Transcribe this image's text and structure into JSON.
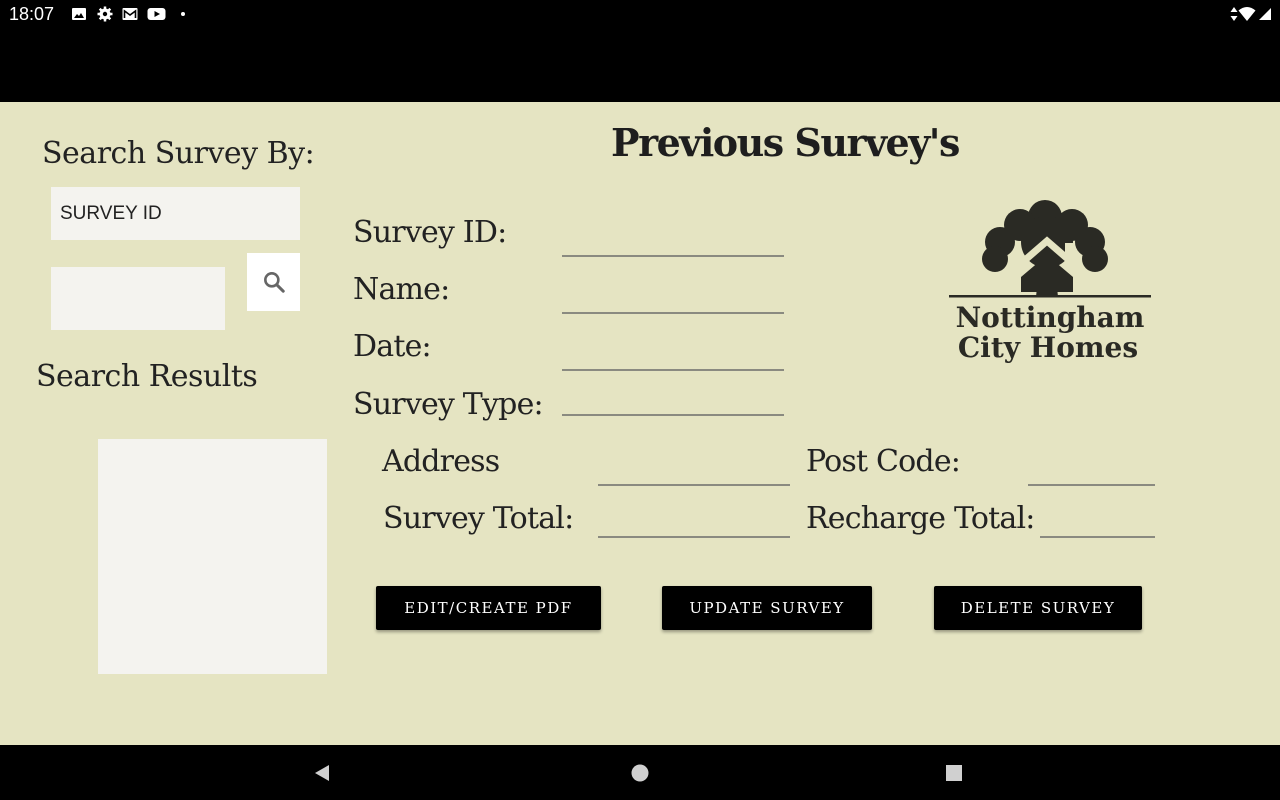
{
  "status_bar": {
    "time": "18:07",
    "icons": [
      "image-icon",
      "gear-icon",
      "gmail-icon",
      "youtube-icon",
      "dot-icon",
      "data-arrows-icon",
      "wifi-icon"
    ]
  },
  "search": {
    "heading": "Search Survey By:",
    "selected_option": "SURVEY ID",
    "input_value": "",
    "button_icon": "search-icon",
    "results_heading": "Search Results"
  },
  "form": {
    "title": "Previous Survey's",
    "fields": {
      "survey_id": {
        "label": "Survey ID:",
        "value": ""
      },
      "name": {
        "label": "Name:",
        "value": ""
      },
      "date": {
        "label": "Date:",
        "value": ""
      },
      "survey_type": {
        "label": "Survey Type:",
        "value": ""
      },
      "address": {
        "label": "Address",
        "value": ""
      },
      "post_code": {
        "label": "Post Code:",
        "value": ""
      },
      "survey_total": {
        "label": "Survey Total:",
        "value": ""
      },
      "recharge_total": {
        "label": "Recharge Total:",
        "value": ""
      }
    }
  },
  "logo": {
    "line1": "Nottingham",
    "line2": "City Homes"
  },
  "buttons": {
    "edit_pdf": "EDIT/CREATE PDF",
    "update": "UPDATE SURVEY",
    "delete": "DELETE SURVEY"
  },
  "nav_bar": {
    "icons": [
      "back-icon",
      "home-icon",
      "recents-icon"
    ]
  },
  "colors": {
    "background": "#e5e4c2",
    "field_bg": "#f4f3ef",
    "button_bg": "#000000",
    "text": "#222222"
  }
}
